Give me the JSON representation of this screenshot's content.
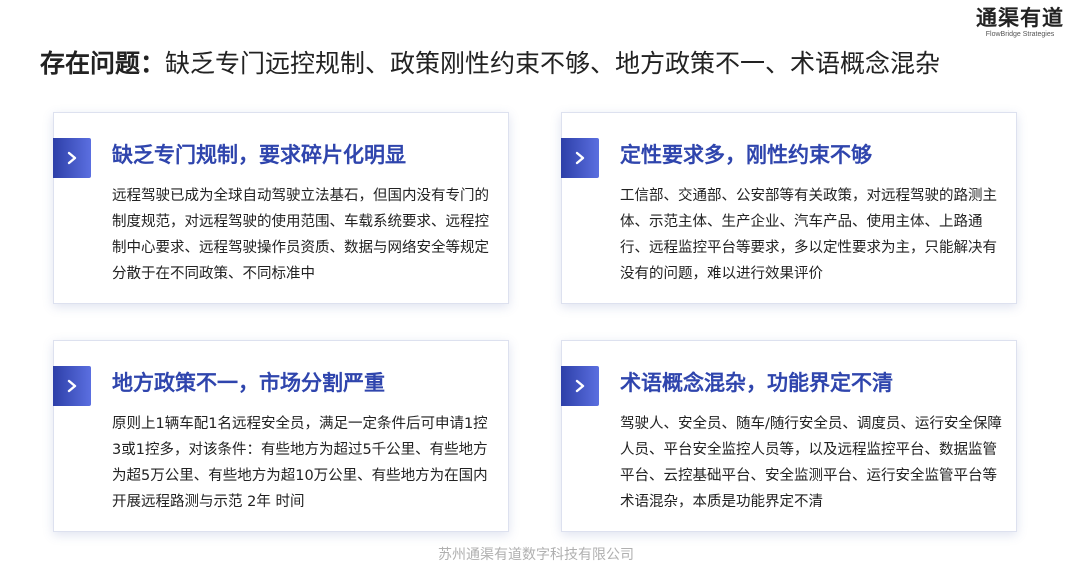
{
  "logo": {
    "name_cn": "通渠有道",
    "name_en": "FlowBridge Strategies"
  },
  "title": {
    "prefix": "存在问题",
    "separator": "：",
    "text": "缺乏专门远控规制、政策刚性约束不够、地方政策不一、术语概念混杂"
  },
  "cards": [
    {
      "icon": "chevron-right-icon",
      "title": "缺乏专门规制，要求碎片化明显",
      "body": "远程驾驶已成为全球自动驾驶立法基石，但国内没有专门的制度规范，对远程驾驶的使用范围、车载系统要求、远程控制中心要求、远程驾驶操作员资质、数据与网络安全等规定分散于在不同政策、不同标准中"
    },
    {
      "icon": "chevron-right-icon",
      "title": "定性要求多，刚性约束不够",
      "body": "工信部、交通部、公安部等有关政策，对远程驾驶的路测主体、示范主体、生产企业、汽车产品、使用主体、上路通行、远程监控平台等要求，多以定性要求为主，只能解决有没有的问题，难以进行效果评价"
    },
    {
      "icon": "chevron-right-icon",
      "title": "地方政策不一，市场分割严重",
      "body": "原则上1辆车配1名远程安全员，满足一定条件后可申请1控3或1控多，对该条件：有些地方为超过5千公里、有些地方为超5万公里、有些地方为超10万公里、有些地方为在国内开展远程路测与示范 2年 时间"
    },
    {
      "icon": "chevron-right-icon",
      "title": "术语概念混杂，功能界定不清",
      "body": "驾驶人、安全员、随车/随行安全员、调度员、运行安全保障人员、平台安全监控人员等，以及远程监控平台、数据监管平台、云控基础平台、安全监测平台、运行安全监管平台等术语混杂，本质是功能界定不清"
    }
  ],
  "footer": {
    "company": "苏州通渠有道数字科技有限公司"
  },
  "colors": {
    "accent": "#2f45ad",
    "icon_gradient_start": "#2d3fa8",
    "icon_gradient_end": "#5b6fe0",
    "footer_text": "#b0b0b0"
  }
}
